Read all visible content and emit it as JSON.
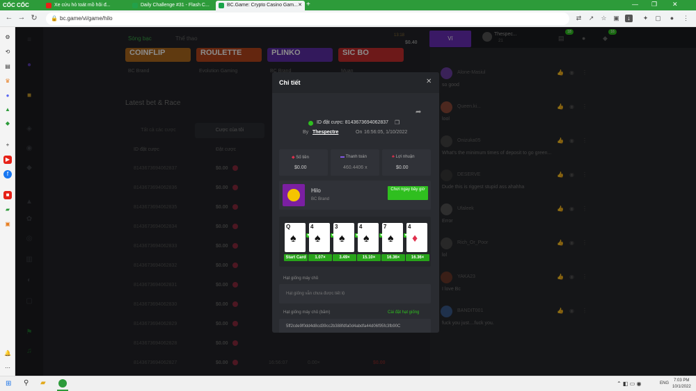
{
  "browser": {
    "brand": "CỐC CỐC",
    "tabs": [
      {
        "title": "Xe cứu hỏ toát mồ hôi đ..."
      },
      {
        "title": "Daily Challenge #31 - Flash C..."
      },
      {
        "title": "BC.Game: Crypto Casino Gam..."
      }
    ],
    "url": "bc.game/vi/game/hilo"
  },
  "site": {
    "nav_tabs": [
      "Sòng bạc",
      "Thể thao"
    ],
    "balance_time": "13:18",
    "balance": "$0.40",
    "wallet_label": "Ví",
    "username": "Thespec...",
    "user_level": "21",
    "badges": [
      "18",
      "16"
    ],
    "game_cards": [
      "COINFLIP",
      "ROULETTE",
      "PLINKO",
      "SIC BO"
    ],
    "game_providers": [
      "BC Brand",
      "Evolution Gaming",
      "BC Brand",
      "Muan"
    ],
    "section_title": "Latest bet & Race",
    "bet_tabs": [
      "Tất cả các cược",
      "Cược của tôi",
      "T"
    ],
    "table_headers": [
      "ID đặt cược",
      "Đặt cược",
      "T"
    ],
    "rows": [
      {
        "id": "8143673694062837",
        "amt": "$0.00"
      },
      {
        "id": "8143673694062836",
        "amt": "$0.00"
      },
      {
        "id": "8143673694062835",
        "amt": "$0.00"
      },
      {
        "id": "8143673694062834",
        "amt": "$0.00"
      },
      {
        "id": "8143673694062833",
        "amt": "$0.00"
      },
      {
        "id": "8143673694062832",
        "amt": "$0.00"
      },
      {
        "id": "8143673694062831",
        "amt": "$0.00"
      },
      {
        "id": "8143673694062830",
        "amt": "$0.00"
      },
      {
        "id": "8143673694062829",
        "amt": "$0.00"
      },
      {
        "id": "8143673694062828",
        "amt": "$0.00"
      },
      {
        "id": "8143673694062827",
        "amt": "$0.00",
        "time": "16:56:07",
        "mult": "0.00×",
        "profit": "$0.00"
      },
      {
        "id": "8143673694062826",
        "amt": "$0.00",
        "time": "16:56:06",
        "mult": "0.00×",
        "profit": "$0.00"
      }
    ]
  },
  "chat": {
    "messages": [
      {
        "name": "Alone-Masiul",
        "text": "so good"
      },
      {
        "name": "Queen.ki...",
        "text": "lool"
      },
      {
        "name": "Onizuka05",
        "text": "What's the minimum times of deposit to go green..."
      },
      {
        "name": "DESERVE",
        "text": "Dude this is riggest stupid ass ahahha"
      },
      {
        "name": "Ufaleek",
        "text": "Error"
      },
      {
        "name": "Rich_Or_Poor",
        "text": "lol"
      },
      {
        "name": "YAKA23",
        "text": "I love Bc"
      },
      {
        "name": "BANDIT001",
        "text": "fuck you just....fuck you."
      }
    ]
  },
  "modal": {
    "title": "Chi tiết",
    "bet_id_label": "ID đặt cược: 8143673694062837",
    "by_label": "By",
    "by_user": "Thespectre",
    "on_label": "On",
    "date": "16:56:05, 1/10/2022",
    "stats": [
      {
        "label": "Số tiền",
        "value": "$0.00"
      },
      {
        "label": "Thanh toán",
        "value": "460.4406 x"
      },
      {
        "label": "Lợi nhuận",
        "value": "$0.00"
      }
    ],
    "game_name": "Hilo",
    "game_provider": "BC Brand",
    "play_button": "Chơi ngay bây giờ",
    "cards": [
      {
        "rank": "Q",
        "suit": "♠"
      },
      {
        "rank": "4",
        "suit": "♠"
      },
      {
        "rank": "3",
        "suit": "♠"
      },
      {
        "rank": "4",
        "suit": "♠"
      },
      {
        "rank": "7",
        "suit": "♠"
      },
      {
        "rank": "4",
        "suit": "♦"
      }
    ],
    "multipliers": [
      "Start Card",
      "1.07×",
      "3.49×",
      "15.10×",
      "16.36×",
      "16.36×"
    ],
    "seed_label": "Hạt giống máy chủ",
    "seed_placeholder": "Hạt giống vẫn chưa được tiết lộ",
    "hashed_seed_label": "Hạt giống máy chủ (băm)",
    "set_seed_link": "Cài đặt hạt giống",
    "hashed_seed": "5ff2cde9f0dd4d8cd39cc2b388fdfa0d4abdfa44d06f95fc3fb90C"
  },
  "taskbar": {
    "lang": "ENG",
    "time": "7:03 PM",
    "date": "10/1/2022"
  },
  "colors": {
    "accent_green": "#2fbf1f",
    "accent_purple": "#6b2fb8"
  }
}
